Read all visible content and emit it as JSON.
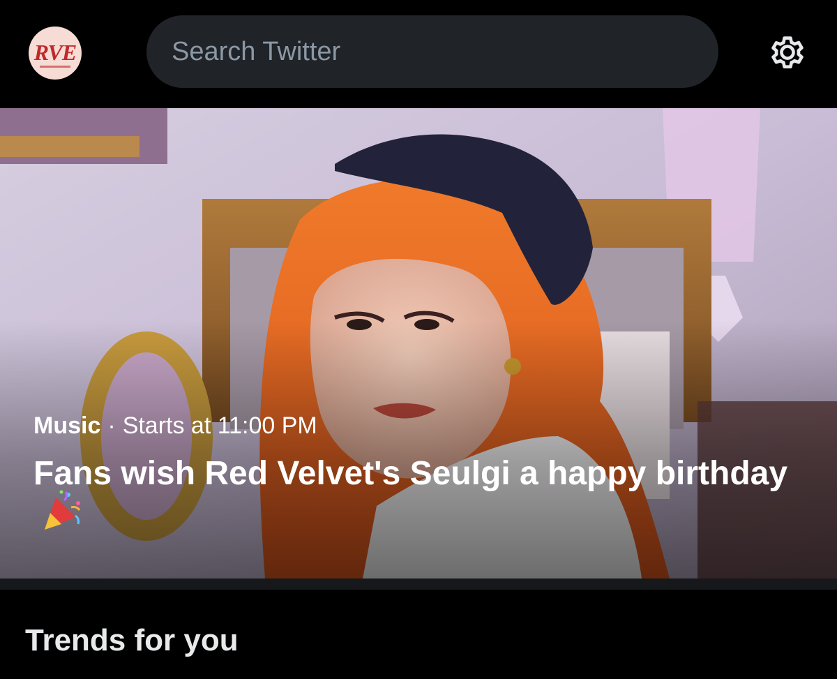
{
  "header": {
    "avatar_text": "RVE",
    "search_placeholder": "Search Twitter",
    "settings_icon": "gear-icon"
  },
  "event": {
    "category": "Music",
    "separator": "·",
    "time": "Starts at 11:00 PM",
    "title": "Fans wish Red Velvet's Seulgi a happy birthday",
    "emoji_icon": "party-popper-icon"
  },
  "trends": {
    "heading": "Trends for you"
  },
  "colors": {
    "background": "#000000",
    "search_bg": "#202327",
    "placeholder": "#8b98a5",
    "text_primary": "#e7e9ea",
    "avatar_red": "#c0282a"
  }
}
